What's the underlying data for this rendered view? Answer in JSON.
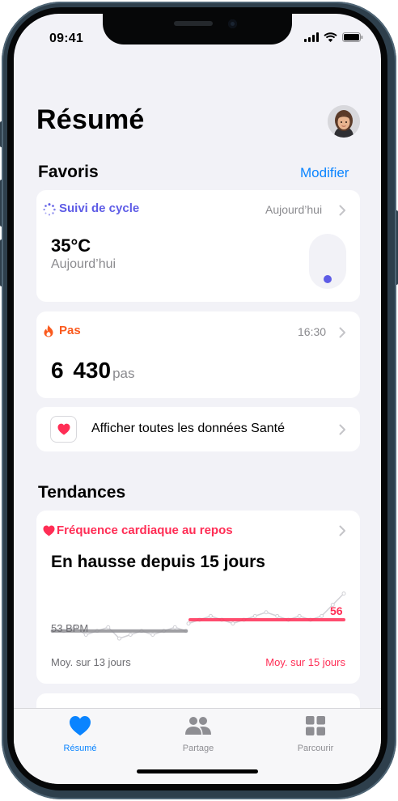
{
  "status": {
    "time": "09:41"
  },
  "header": {
    "title": "Résumé"
  },
  "favorites": {
    "title": "Favoris",
    "edit_label": "Modifier",
    "cycle": {
      "label": "Suivi de cycle",
      "time": "Aujourd’hui",
      "value": "35°C",
      "sub": "Aujourd’hui",
      "color": "#5e5ce6"
    },
    "steps": {
      "label": "Pas",
      "time": "16:30",
      "value": "6 430",
      "unit": "pas",
      "color": "#fa5a1e"
    },
    "show_all": {
      "label": "Afficher toutes les données Santé"
    }
  },
  "trends": {
    "title": "Tendances",
    "heart": {
      "label": "Fréquence cardiaque au repos",
      "headline": "En hausse depuis 15 jours",
      "color": "#ff2d55",
      "chart_data": {
        "type": "line",
        "series": [
          {
            "name": "Moy. sur 13 jours",
            "values": [
              53,
              53,
              54,
              52,
              53,
              54,
              51,
              52,
              53,
              52,
              53,
              54,
              53
            ],
            "avg": 53
          },
          {
            "name": "Moy. sur 15 jours",
            "values": [
              55,
              56,
              57,
              56,
              55,
              56,
              57,
              58,
              57,
              56,
              57,
              56,
              57,
              60,
              63
            ],
            "avg": 56
          }
        ],
        "avg_label_low": "53 BPM",
        "avg_label_high": "56",
        "legend_left": "Moy. sur 13 jours",
        "legend_right": "Moy. sur 15 jours"
      }
    }
  },
  "tabbar": {
    "tabs": [
      {
        "label": "Résumé",
        "icon": "heart-icon",
        "active": true
      },
      {
        "label": "Partage",
        "icon": "people-icon",
        "active": false
      },
      {
        "label": "Parcourir",
        "icon": "grid-icon",
        "active": false
      }
    ],
    "accent": "#0a84ff",
    "inactive": "#8e8e93"
  }
}
